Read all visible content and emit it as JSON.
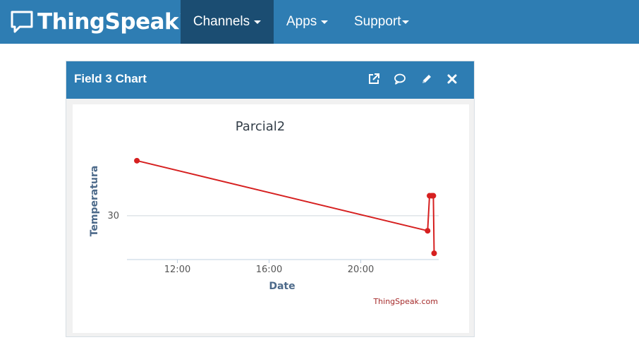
{
  "navbar": {
    "brand": "ThingSpeak",
    "brand_tm": "™",
    "items": [
      {
        "label": "Channels"
      },
      {
        "label": "Apps"
      },
      {
        "label": "Support"
      }
    ]
  },
  "panel": {
    "title": "Field 3 Chart",
    "icons": [
      "external-link-icon",
      "comment-icon",
      "pencil-icon",
      "close-icon"
    ]
  },
  "colors": {
    "nav_bg": "#2e7db3",
    "nav_active": "#1b4d72",
    "series": "#d62020"
  },
  "chart_data": {
    "type": "line",
    "title": "Parcial2",
    "xlabel": "Date",
    "ylabel": "Temperatura",
    "x_ticks": [
      "12:00",
      "16:00",
      "20:00"
    ],
    "y_ticks": [
      30
    ],
    "credit": "ThingSpeak.com",
    "series": [
      {
        "values": [
          {
            "x": "10:14",
            "y": 32.2
          },
          {
            "x": "22:55",
            "y": 29.4
          },
          {
            "x": "23:00",
            "y": 30.8
          },
          {
            "x": "23:06",
            "y": 30.8
          },
          {
            "x": "23:10",
            "y": 30.8
          },
          {
            "x": "23:12",
            "y": 28.5
          }
        ]
      }
    ]
  }
}
